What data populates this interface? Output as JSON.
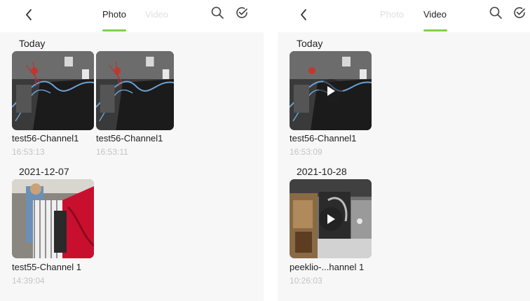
{
  "photo_screen": {
    "tabs": {
      "photo": "Photo",
      "video": "Video",
      "active": "photo"
    },
    "groups": [
      {
        "date": "Today",
        "items": [
          {
            "name": "test56-Channel1",
            "time": "16:53:13"
          },
          {
            "name": "test56-Channel1",
            "time": "16:53:11"
          }
        ]
      },
      {
        "date": "2021-12-07",
        "items": [
          {
            "name": "test55-Channel 1",
            "time": "14:39:04"
          }
        ]
      }
    ]
  },
  "video_screen": {
    "tabs": {
      "photo": "Photo",
      "video": "Video",
      "active": "video"
    },
    "groups": [
      {
        "date": "Today",
        "items": [
          {
            "name": "test56-Channel1",
            "time": "16:53:09"
          }
        ]
      },
      {
        "date": "2021-10-28",
        "items": [
          {
            "name": "peeklio-...hannel 1",
            "time": "10:26:03"
          }
        ]
      }
    ]
  },
  "colors": {
    "accent": "#7fd04a",
    "time_text": "#c4c4c4",
    "inactive_tab": "#e0e0e0"
  },
  "icons": {
    "back": "chevron-left-icon",
    "search": "search-icon",
    "select": "check-circle-icon",
    "play": "play-icon"
  }
}
